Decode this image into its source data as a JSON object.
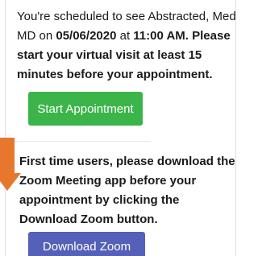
{
  "appointment": {
    "intro": "You're scheduled to see Abstracted, Med MD on ",
    "date": "05/06/2020",
    "at": " at ",
    "time": "11:00 AM",
    "period": ".",
    "instruction": "Please start your virtual visit at least 15 minutes before your appointment.",
    "start_button_label": "Start Appointment"
  },
  "zoom_notice": {
    "text": "First time users, please download the Zoom Meeting app before your appointment by clicking the Download Zoom button.",
    "download_button_label": "Download Zoom"
  },
  "colors": {
    "start_button": "#3bb54a",
    "download_button": "#5560b8",
    "arrow": "#e8772e"
  },
  "icons": {
    "arrow": "down-arrow-icon"
  }
}
